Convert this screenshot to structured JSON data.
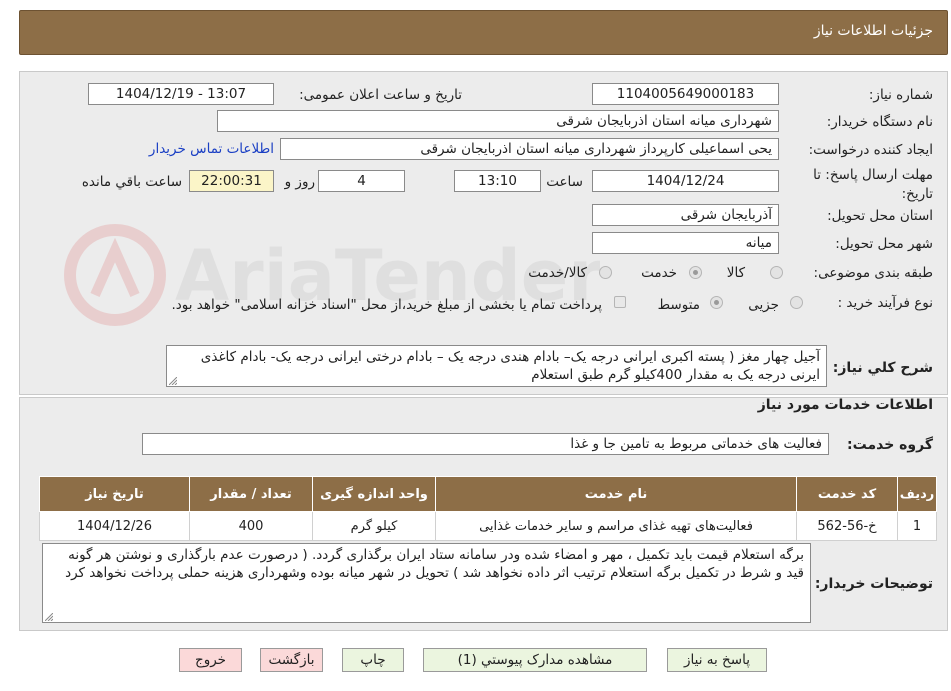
{
  "header": {
    "title": "جزئیات اطلاعات نیاز"
  },
  "need_number": {
    "label": "شماره نیاز:",
    "value": "1104005649000183"
  },
  "announce_datetime": {
    "label": "تاریخ و ساعت اعلان عمومی:",
    "value": "1404/12/19 - 13:07"
  },
  "buyer_org": {
    "label": "نام دستگاه خریدار:",
    "value": "شهرداری میانه استان اذربایجان شرقی"
  },
  "requester": {
    "label": "ایجاد کننده درخواست:",
    "value": "یحی اسماعیلی  کارپرداز شهرداری میانه استان اذربایجان شرقی",
    "contact_link": "اطلاعات تماس خریدار"
  },
  "deadline": {
    "label": "مهلت ارسال پاسخ: تا تاریخ:",
    "date": "1404/12/24",
    "time_label": "ساعت",
    "time": "13:10",
    "days": "4",
    "days_label": "روز و",
    "remaining": "22:00:31",
    "remaining_label": "ساعت باقي مانده"
  },
  "delivery_province": {
    "label": "استان محل تحویل:",
    "value": "آذربایجان شرقی"
  },
  "delivery_city": {
    "label": "شهر محل تحویل:",
    "value": "میانه"
  },
  "category": {
    "label": "طبقه بندی موضوعی:",
    "options": [
      "کالا",
      "خدمت",
      "کالا/خدمت"
    ],
    "selected": "خدمت"
  },
  "process_type": {
    "label": "نوع فرآیند خرید :",
    "options": [
      "جزیی",
      "متوسط"
    ],
    "selected": "متوسط",
    "note": "پرداخت تمام یا بخشی از مبلغ خرید،از محل \"اسناد خزانه اسلامی\" خواهد بود."
  },
  "general_description": {
    "label": "شرح کلي نیاز:",
    "value": "آجیل چهار مغز ( پسته اکبری ایرانی درجه یک– بادام هندی درجه یک – بادام درختی ایرانی درجه یک- بادام کاغذی ایرنی درجه یک به مقدار 400کیلو گرم طبق استعلام"
  },
  "services_section": {
    "title": "اطلاعات خدمات مورد نیاز"
  },
  "service_group": {
    "label": "گروه خدمت:",
    "value": "فعالیت های خدماتی مربوط به تامین جا و غذا"
  },
  "table": {
    "headers": [
      "ردیف",
      "کد خدمت",
      "نام خدمت",
      "واحد اندازه گیری",
      "تعداد / مقدار",
      "تاریخ نیاز"
    ],
    "rows": [
      [
        "1",
        "خ-56-562",
        "فعالیت‌های تهیه غذای مراسم و سایر خدمات غذایی",
        "کیلو گرم",
        "400",
        "1404/12/26"
      ]
    ]
  },
  "buyer_notes": {
    "label": "توضیحات خریدار:",
    "value": "برگه استعلام قیمت باید تکمیل ، مهر و امضاء شده ودر سامانه ستاد ایران برگذاری گردد. ( درصورت عدم بارگذاری و نوشتن هر گونه قید و شرط در تکمیل برگه استعلام  ترتیب اثر داده نخواهد شد ) تحویل در شهر میانه بوده وشهرداری هزینه حملی پرداخت نخواهد کرد"
  },
  "buttons": {
    "reply": "پاسخ به نیاز",
    "view_docs": "مشاهده مدارک پیوستي (1)",
    "print": "چاپ",
    "back": "بازگشت",
    "exit": "خروج"
  },
  "watermark": {
    "text": "AriaTender.neT"
  },
  "colors": {
    "header": "#8d6e47",
    "link": "#1a3fc4",
    "button_green": "#ebf5df",
    "button_pink": "#fbd9d9"
  }
}
